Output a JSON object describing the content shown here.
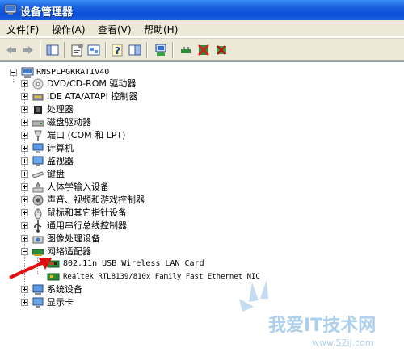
{
  "window": {
    "title": "设备管理器"
  },
  "menu": [
    {
      "label": "文件(F)"
    },
    {
      "label": "操作(A)"
    },
    {
      "label": "查看(V)"
    },
    {
      "label": "帮助(H)"
    }
  ],
  "tree": {
    "root": "RNSPLPGKRATIV40",
    "items": [
      {
        "label": "DVD/CD-ROM 驱动器",
        "icon": "cdrom-icon"
      },
      {
        "label": "IDE ATA/ATAPI 控制器",
        "icon": "ide-controller-icon"
      },
      {
        "label": "处理器",
        "icon": "processor-icon"
      },
      {
        "label": "磁盘驱动器",
        "icon": "disk-drive-icon"
      },
      {
        "label": "端口 (COM 和 LPT)",
        "icon": "port-icon"
      },
      {
        "label": "计算机",
        "icon": "computer-icon"
      },
      {
        "label": "监视器",
        "icon": "monitor-icon"
      },
      {
        "label": "键盘",
        "icon": "keyboard-icon"
      },
      {
        "label": "人体学输入设备",
        "icon": "hid-icon"
      },
      {
        "label": "声音、视频和游戏控制器",
        "icon": "sound-icon"
      },
      {
        "label": "鼠标和其它指针设备",
        "icon": "mouse-icon"
      },
      {
        "label": "通用串行总线控制器",
        "icon": "usb-icon"
      },
      {
        "label": "图像处理设备",
        "icon": "imaging-icon"
      },
      {
        "label": "网络适配器",
        "icon": "network-adapter-icon",
        "expanded": true,
        "children": [
          {
            "label": "802.11n USB Wireless LAN Card",
            "icon": "network-card-icon"
          },
          {
            "label": "Realtek RTL8139/810x Family Fast Ethernet NIC",
            "icon": "network-card-icon"
          }
        ]
      },
      {
        "label": "系统设备",
        "icon": "system-device-icon"
      },
      {
        "label": "显示卡",
        "icon": "display-adapter-icon"
      }
    ]
  },
  "watermark": {
    "text": "我爱IT技术网",
    "url": "www.52ij.com"
  },
  "colors": {
    "titlebar": "#0a4fd8",
    "chrome": "#ece9d8",
    "arrow": "#e01010"
  }
}
